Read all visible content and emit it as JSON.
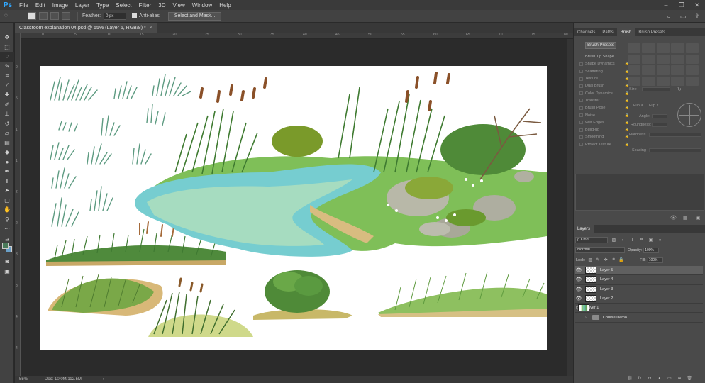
{
  "app": {
    "logo": "Ps",
    "menu": [
      "File",
      "Edit",
      "Image",
      "Layer",
      "Type",
      "Select",
      "Filter",
      "3D",
      "View",
      "Window",
      "Help"
    ],
    "window_controls": [
      "minimize-icon",
      "restore-icon",
      "close-icon"
    ]
  },
  "options_bar": {
    "feather_label": "Feather:",
    "feather_value": "0 px",
    "antialias_label": "Anti-alias",
    "antialias_checked": true,
    "select_mask_label": "Select and Mask...",
    "right_icons": [
      "search-icon",
      "workspace-icon",
      "share-icon"
    ]
  },
  "document": {
    "tab_title": "Classroom explanation 04.psd @ 55% (Layer 5, RGB/8) *",
    "tab_close": "×",
    "ruler_h": [
      "0",
      "5",
      "10",
      "15",
      "20",
      "25",
      "30",
      "35",
      "40",
      "45",
      "50",
      "55",
      "60",
      "65",
      "70",
      "75",
      "80"
    ],
    "ruler_v": [
      "0",
      "5",
      "1",
      "1",
      "2",
      "2",
      "3",
      "3",
      "4",
      "4",
      "5"
    ],
    "zoom": "55%",
    "doc_size": "Doc: 10.0M/112.5M",
    "status_arrow": "›"
  },
  "brush_panel": {
    "tabs": [
      "Channels",
      "Paths",
      "Brush",
      "Brush Presets"
    ],
    "active_tab": "Brush",
    "presets_button": "Brush Presets",
    "tip_header": "Brush Tip Shape",
    "options": [
      "Shape Dynamics",
      "Scattering",
      "Texture",
      "Dual Brush",
      "Color Dynamics",
      "Transfer",
      "Brush Pose",
      "Noise",
      "Wet Edges",
      "Build-up",
      "Smoothing",
      "Protect Texture"
    ],
    "lock_glyph": "🔒",
    "size_label": "Size",
    "flip_x": "Flip X",
    "flip_y": "Flip Y",
    "angle_label": "Angle:",
    "roundness_label": "Roundness:",
    "hardness_label": "Hardness",
    "spacing_label": "Spacing"
  },
  "layers_panel": {
    "tab": "Layers",
    "kind_label": "ρ Kind",
    "blend_mode": "Normal",
    "opacity_label": "Opacity:",
    "opacity_value": "100%",
    "lock_label": "Lock:",
    "fill_label": "Fill:",
    "fill_value": "100%",
    "layers": [
      {
        "name": "Layer 5",
        "selected": true,
        "visible": true,
        "type": "empty"
      },
      {
        "name": "Layer 4",
        "selected": false,
        "visible": true,
        "type": "empty"
      },
      {
        "name": "Layer 3",
        "selected": false,
        "visible": true,
        "type": "empty"
      },
      {
        "name": "Layer 2",
        "selected": false,
        "visible": true,
        "type": "empty"
      },
      {
        "name": "Layer 1",
        "selected": false,
        "visible": true,
        "type": "art"
      },
      {
        "name": "Course Demo",
        "selected": false,
        "visible": false,
        "type": "group"
      }
    ],
    "eye_glyph": "👁",
    "group_arrow": "›",
    "bottom_icons": [
      "link-icon",
      "fx-icon",
      "mask-icon",
      "adjustment-icon",
      "folder-icon",
      "new-layer-icon",
      "trash-icon"
    ]
  },
  "colors": {
    "foreground": "#4a7a5a",
    "background": "#6aa0c8",
    "accent": "#31a8ff"
  }
}
